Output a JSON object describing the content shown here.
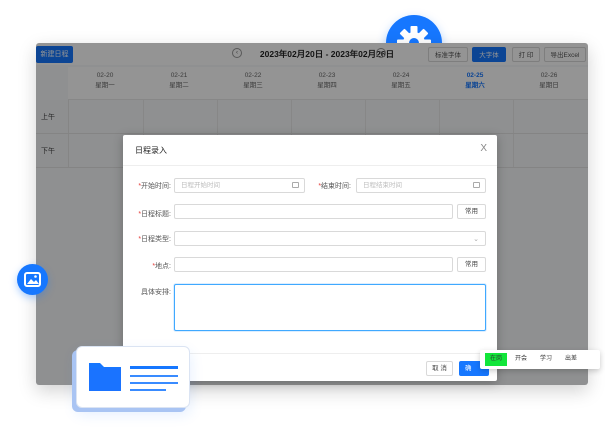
{
  "toolbar": {
    "new_schedule": "新建日程",
    "week_range": "2023年02月20日 - 2023年02月26日",
    "prev_icon": "chevron-left-icon",
    "next_icon": "chevron-right-icon",
    "standard_font": "标准字体",
    "large_font": "大字体",
    "print": "打 印",
    "export_excel": "导出Excel"
  },
  "days": [
    {
      "date": "02-20",
      "weekday": "星期一"
    },
    {
      "date": "02-21",
      "weekday": "星期二"
    },
    {
      "date": "02-22",
      "weekday": "星期三"
    },
    {
      "date": "02-23",
      "weekday": "星期四"
    },
    {
      "date": "02-24",
      "weekday": "星期五"
    },
    {
      "date": "02-25",
      "weekday": "星期六"
    },
    {
      "date": "02-26",
      "weekday": "星期日"
    }
  ],
  "rows": [
    "上午",
    "下午"
  ],
  "dialog": {
    "title": "日程录入",
    "close": "X",
    "start_label": "开始时间:",
    "start_placeholder": "日程开始时间",
    "end_label": "结束时间:",
    "end_placeholder": "日程结束时间",
    "title_label": "日程标题:",
    "type_label": "日程类型:",
    "location_label": "地点:",
    "detail_label": "具体安排:",
    "common_button": "常用",
    "cancel": "取 消",
    "confirm": "确"
  },
  "tags": [
    "在岗",
    "开会",
    "学习",
    "出差"
  ],
  "colors": {
    "accent": "#1677ff",
    "highlight_tag": "#12e63a",
    "required": "#e53935"
  },
  "icons": {
    "gear": "gear-icon",
    "image": "image-icon",
    "folder": "folder-icon",
    "calendar": "calendar-icon",
    "dropdown": "chevron-down-icon"
  }
}
